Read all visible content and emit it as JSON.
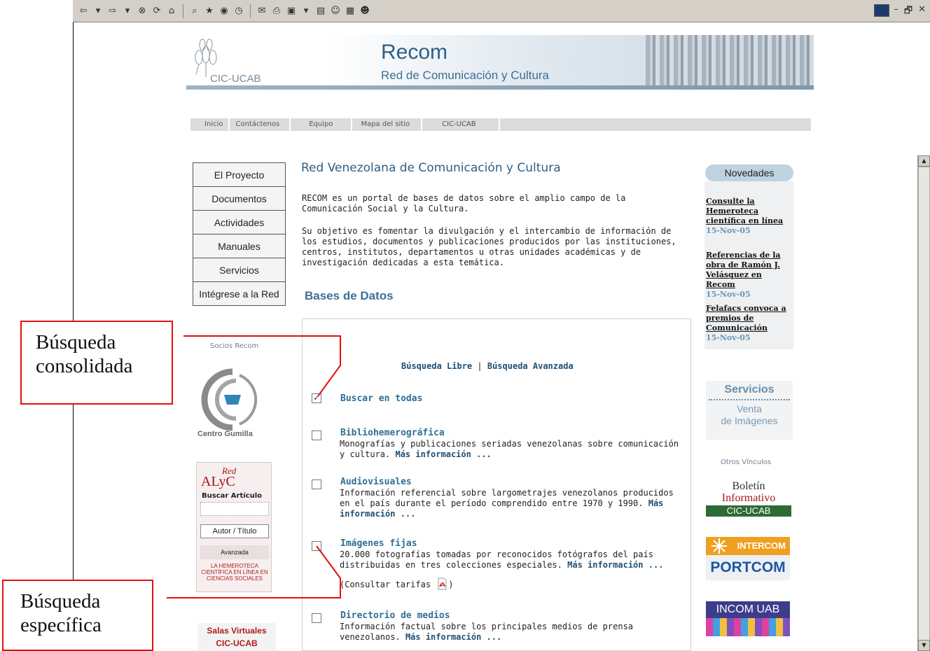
{
  "browser": {
    "toolbar_icons": [
      "back-icon",
      "forward-icon",
      "stop-icon",
      "refresh-icon",
      "home-icon",
      "search-icon",
      "favorites-icon",
      "media-icon",
      "history-icon",
      "mail-icon",
      "print-icon",
      "edit-icon",
      "discuss-icon",
      "messenger-icon",
      "research-icon",
      "emoji-icon"
    ],
    "window_controls": [
      "–",
      "🗗",
      "✕"
    ]
  },
  "header": {
    "logo_text": "CIC-UCAB",
    "title": "Recom",
    "subtitle": "Red de Comunicación y Cultura"
  },
  "topnav": [
    "Inicio",
    "Contáctenos",
    "Equipo",
    "Mapa del sitio",
    "CIC-UCAB"
  ],
  "leftmenu": [
    "El Proyecto",
    "Documentos",
    "Actividades",
    "Manuales",
    "Servicios",
    "Intégrese a la Red"
  ],
  "left": {
    "socios": "Socios Recom",
    "gumilla": "Centro Gumilla",
    "alyc": {
      "red": "Red",
      "name": "ALyC",
      "buscar": "Buscar Artículo",
      "button": "Autor / Título",
      "avanzada": "Avanzada",
      "footer": "LA HEMEROTECA CIENTÍFICA EN LÍNEA EN CIENCIAS SOCIALES"
    },
    "salas_1": "Salas Virtuales",
    "salas_2": "CIC-UCAB"
  },
  "content": {
    "title": "Red Venezolana de Comunicación y Cultura",
    "p1": "RECOM es un portal de bases de datos sobre el amplio campo de la Comunicación Social y la Cultura.",
    "p2": "Su objetivo es fomentar la divulgación y el intercambio de información de los estudios, documentos y publicaciones producidos por las instituciones, centros, institutos, departamentos u otras unidades académicas y de investigación dedicadas a esta temática.",
    "bases_title": "Bases de Datos",
    "search_libre": "Búsqueda Libre",
    "search_sep": "|",
    "search_avanzada": "Búsqueda Avanzada",
    "more_label": "Más información ...",
    "databases": {
      "todas": {
        "title": "Buscar en todas",
        "checked": true
      },
      "biblio": {
        "title": "Bibliohemerográfica",
        "desc": "Monografías y publicaciones seriadas venezolanas sobre comunicación y cultura.",
        "checked": false
      },
      "audio": {
        "title": "Audiovisuales",
        "desc": "Información referencial sobre largometrajes venezolanos producidos en el país durante el período comprendido entre 1970 y 1990.",
        "checked": false
      },
      "imagenes": {
        "title": "Imágenes fijas",
        "desc": "20.000 fotografías tomadas por reconocidos fotógrafos del país distribuidas en tres colecciones especiales.",
        "extra_pre": "(Consultar tarifas ",
        "extra_post": ")",
        "checked": false
      },
      "medios": {
        "title": "Directorio de medios",
        "desc": "Información factual sobre los principales medios de prensa venezolanos.",
        "checked": false
      }
    }
  },
  "novedades": {
    "header": "Novedades",
    "items": [
      {
        "title": "Consulte la Hemeroteca científica en línea",
        "date": "15-Nov-05"
      },
      {
        "title": "Referencias de la obra de Ramón J. Velásquez en Recom",
        "date": "15-Nov-05"
      },
      {
        "title": "Felafacs convoca a premios de Comunicación",
        "date": "15-Nov-05"
      }
    ]
  },
  "servicios": {
    "title": "Servicios",
    "item_1": "Venta",
    "item_2": "de Imágenes"
  },
  "otros": "Otros Vínculos",
  "boletin": {
    "line_1": "Boletín",
    "line_2": "Informativo",
    "line_3": "CIC-UCAB"
  },
  "intercom": {
    "top": "INTERCOM",
    "bottom": "PORTCOM"
  },
  "incom": "INCOM UAB",
  "annotations": {
    "consolidada_1": "Búsqueda",
    "consolidada_2": "consolidada",
    "especifica_1": "Búsqueda",
    "especifica_2": "específica"
  },
  "colors": {
    "accent": "#2f5f86",
    "annotation": "#e01010"
  }
}
